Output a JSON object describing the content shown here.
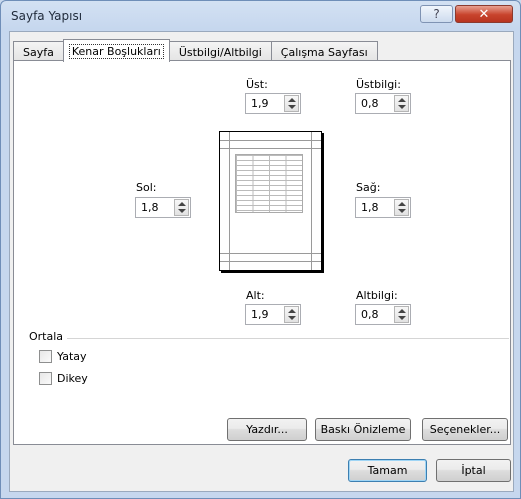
{
  "window": {
    "title": "Sayfa Yapısı",
    "help_glyph": "?",
    "close_glyph": "✕"
  },
  "tabs": [
    {
      "label": "Sayfa"
    },
    {
      "label": "Kenar Boşlukları"
    },
    {
      "label": "Üstbilgi/Altbilgi"
    },
    {
      "label": "Çalışma Sayfası"
    }
  ],
  "margins": {
    "top": {
      "label": "Üst:",
      "value": "1,9"
    },
    "header": {
      "label": "Üstbilgi:",
      "value": "0,8"
    },
    "left": {
      "label": "Sol:",
      "value": "1,8"
    },
    "right": {
      "label": "Sağ:",
      "value": "1,8"
    },
    "bottom": {
      "label": "Alt:",
      "value": "1,9"
    },
    "footer": {
      "label": "Altbilgi:",
      "value": "0,8"
    }
  },
  "center": {
    "group_label": "Ortala",
    "horizontal": {
      "label": "Yatay",
      "checked": false
    },
    "vertical": {
      "label": "Dikey",
      "checked": false
    }
  },
  "buttons": {
    "print": "Yazdır...",
    "preview": "Baskı Önizleme",
    "options": "Seçenekler...",
    "ok": "Tamam",
    "cancel": "İptal"
  },
  "icons": [
    "help-icon",
    "close-icon",
    "spin-arrows-icon",
    "checkbox-icon"
  ],
  "colors": {
    "close": "#c8432c",
    "default_button_border": "#3c7fb1"
  }
}
